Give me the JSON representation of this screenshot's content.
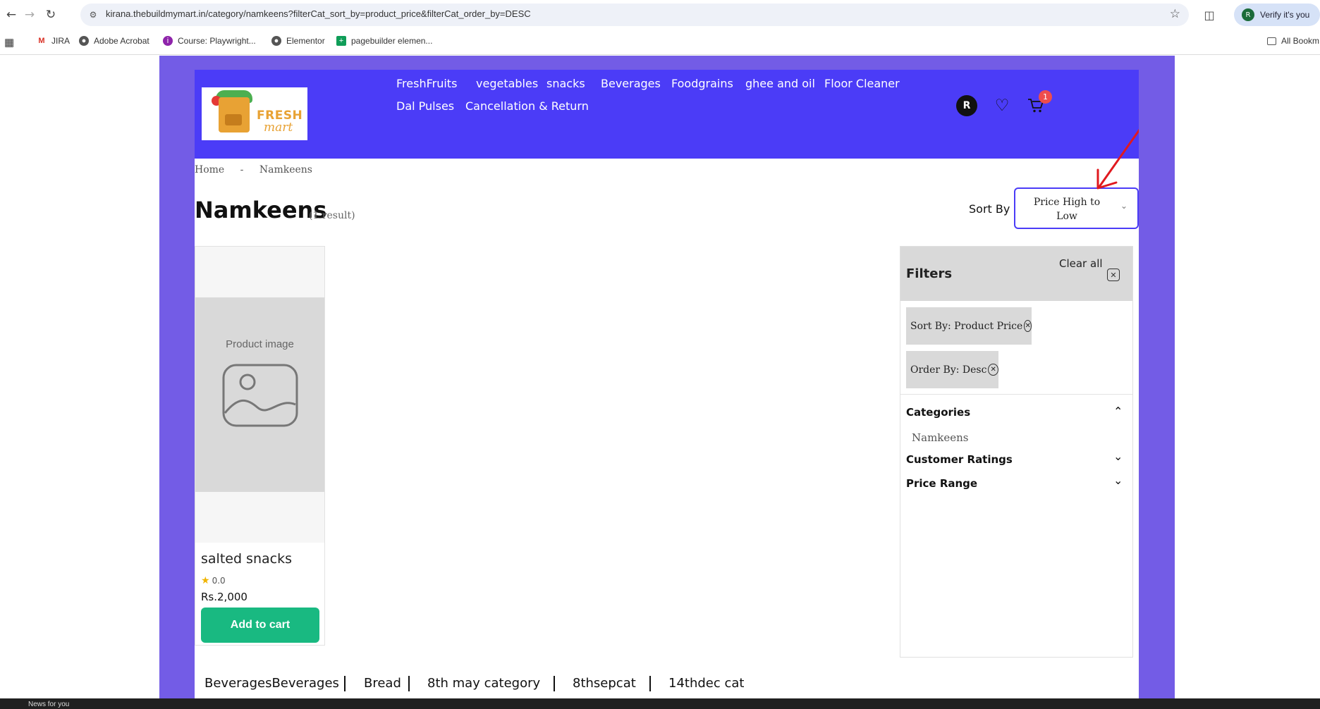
{
  "browser": {
    "url": "kirana.thebuildmymart.in/category/namkeens?filterCat_sort_by=product_price&filterCat_order_by=DESC",
    "profile_label": "Verify it's you",
    "profile_initial": "R",
    "bookmarks": [
      {
        "label": "JIRA",
        "icon": "gmail-icon"
      },
      {
        "label": "Adobe Acrobat",
        "icon": "acrobat-icon"
      },
      {
        "label": "Course: Playwright...",
        "icon": "course-icon"
      },
      {
        "label": "Elementor",
        "icon": "elementor-icon"
      },
      {
        "label": "pagebuilder elemen...",
        "icon": "sheets-icon"
      }
    ],
    "all_bookmarks_label": "All Bookm"
  },
  "header": {
    "logo_text_1": "FRESH",
    "logo_text_2": "mart",
    "nav": [
      "FreshFruits",
      "vegetables",
      "snacks",
      "Beverages",
      "Foodgrains",
      "ghee and oil",
      "Floor Cleaner",
      "Dal Pulses",
      "Cancellation & Return"
    ],
    "user_initial": "R",
    "cart_count": "1"
  },
  "breadcrumb": {
    "home": "Home",
    "separator": "-",
    "current": "Namkeens"
  },
  "page": {
    "title": "Namkeens",
    "result_count": "(1 result)",
    "sort_label": "Sort By",
    "sort_value": "Price High to Low"
  },
  "products": [
    {
      "image_placeholder": "Product image",
      "name": "salted snacks",
      "rating": "0.0",
      "price": "Rs.2,000",
      "button_label": "Add to cart"
    }
  ],
  "filters": {
    "title": "Filters",
    "clear_all": "Clear all",
    "active": [
      "Sort By: Product Price",
      "Order By: Desc"
    ],
    "sections": [
      {
        "label": "Categories",
        "expanded": true,
        "items": [
          "Namkeens"
        ]
      },
      {
        "label": "Customer Ratings",
        "expanded": false
      },
      {
        "label": "Price Range",
        "expanded": false
      }
    ]
  },
  "bottom_categories": [
    "BeveragesBeverages",
    "Bread",
    "8th may category",
    "8thsepcat",
    "14thdec cat"
  ],
  "taskbar": {
    "news_label": "News for you"
  },
  "colors": {
    "header_bg": "#4b3cf7",
    "frame_bg": "#735ce6",
    "add_to_cart": "#19b981",
    "badge": "#ef4d4d",
    "annotation_arrow": "#e0191f"
  }
}
